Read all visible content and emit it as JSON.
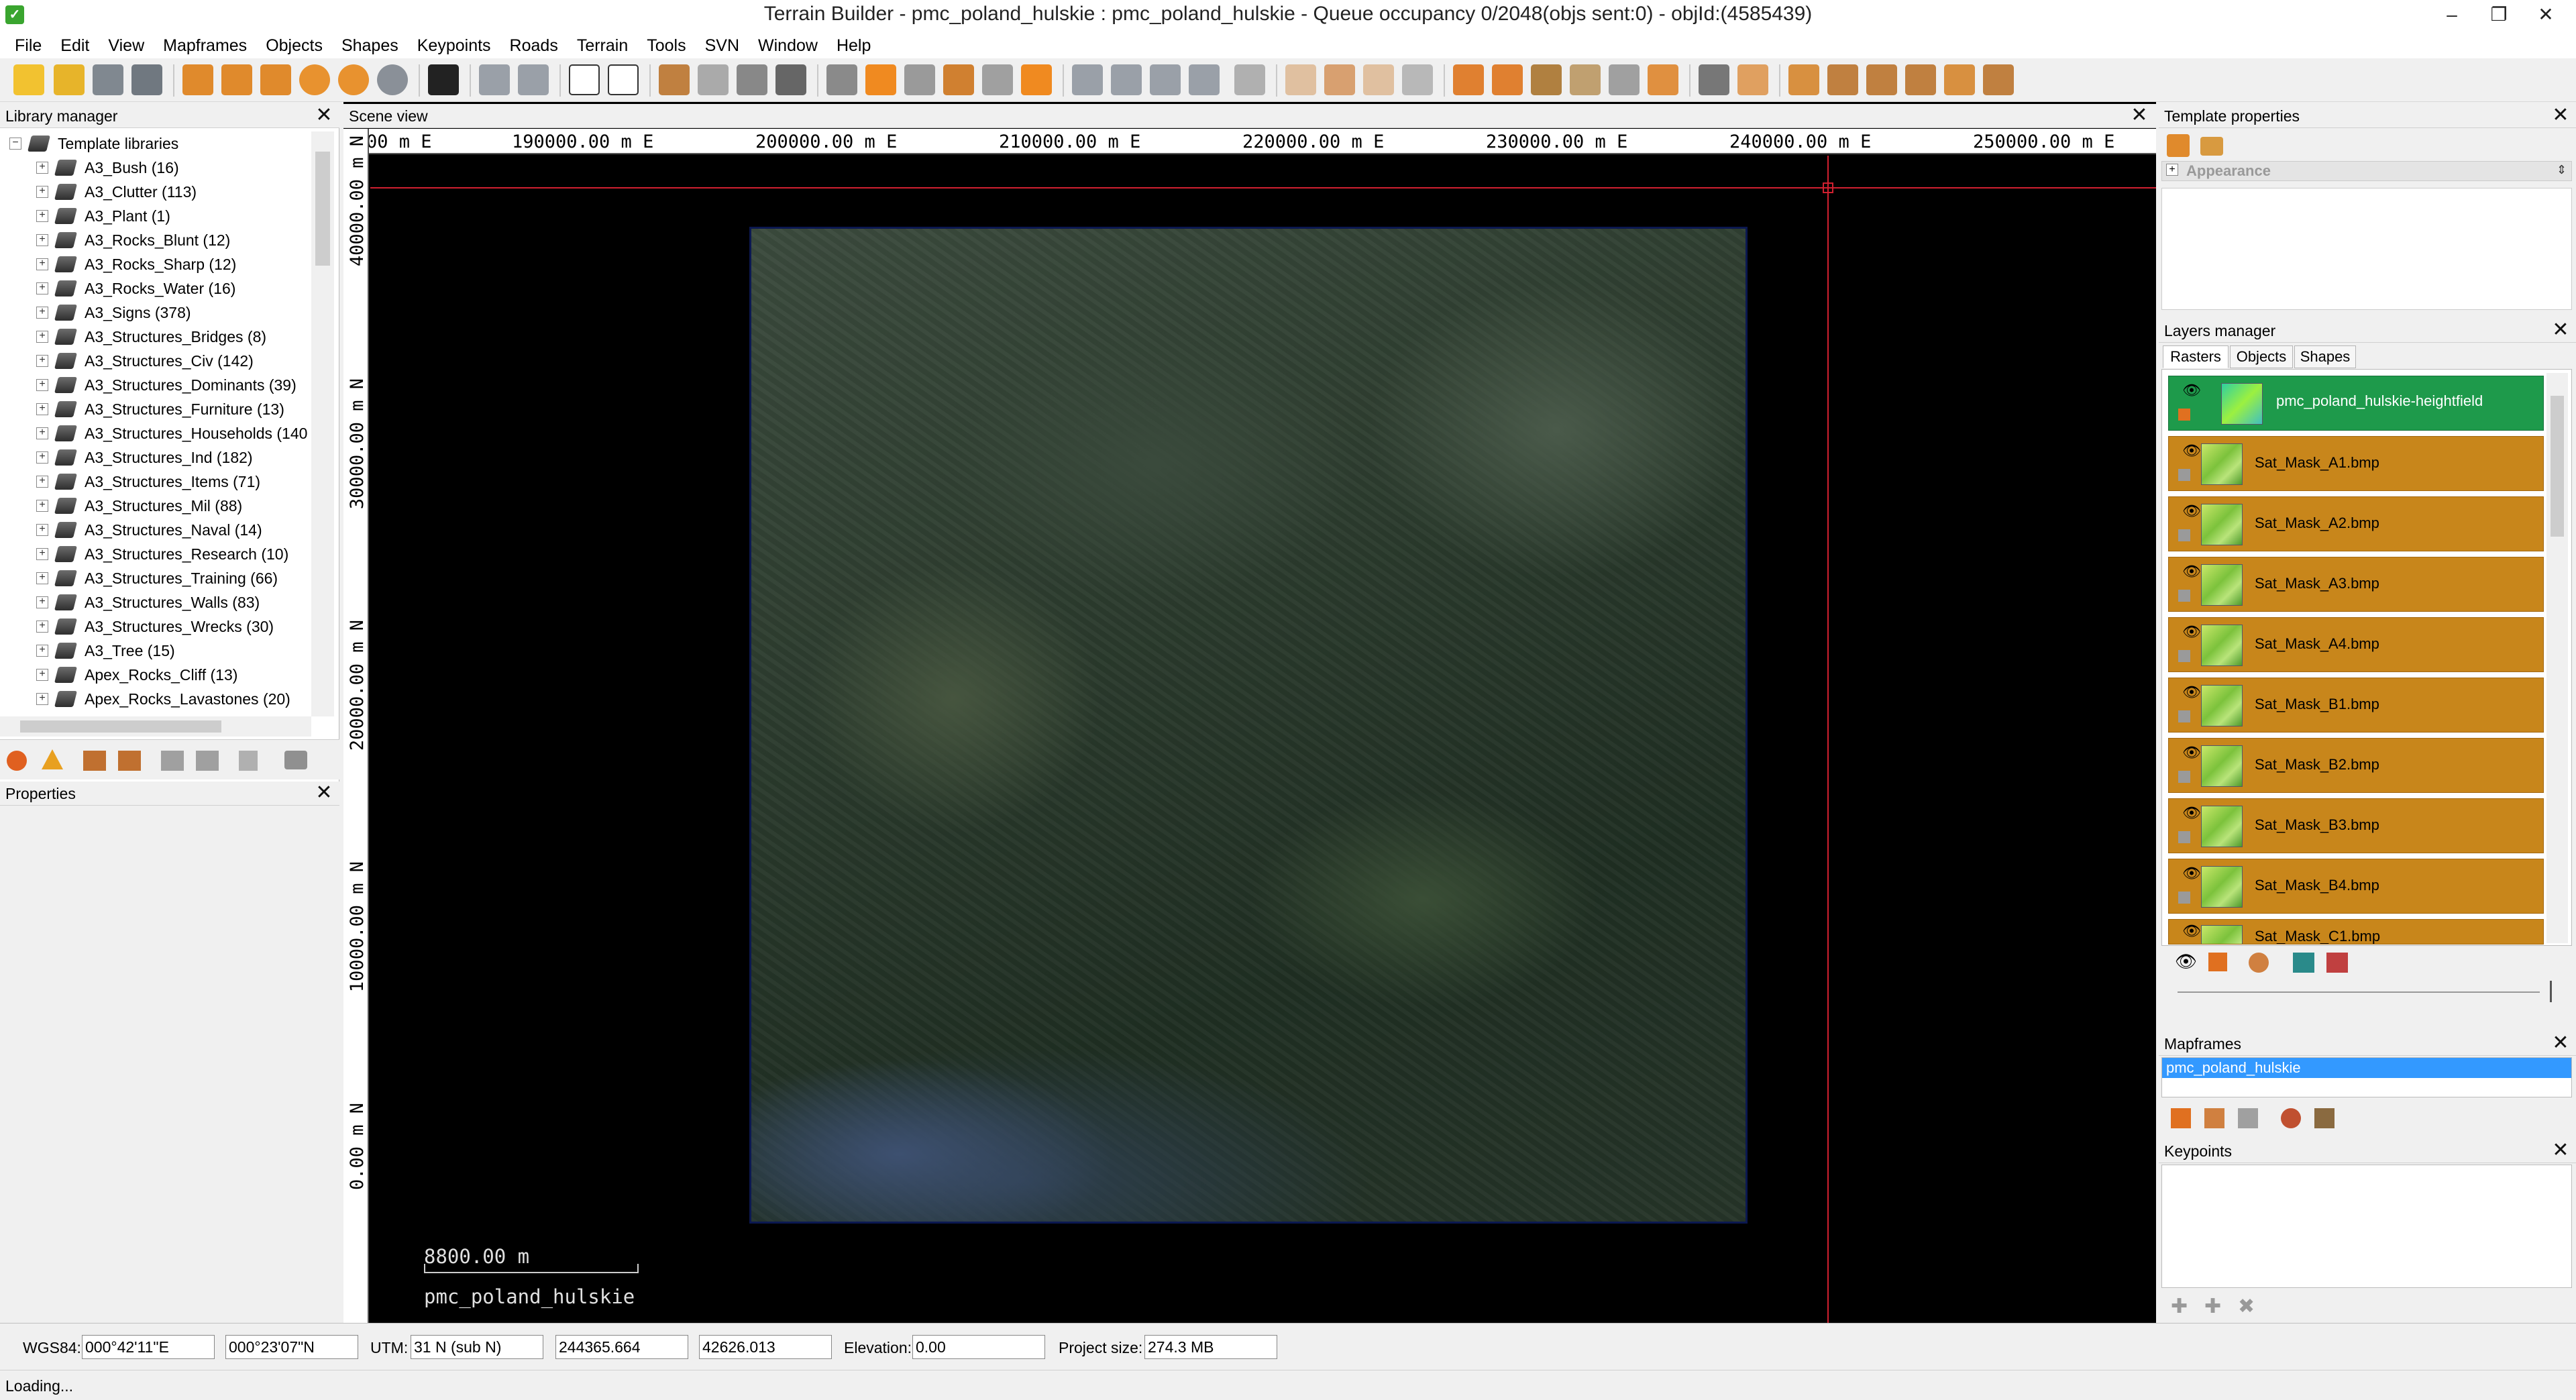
{
  "window": {
    "title": "Terrain Builder - pmc_poland_hulskie : pmc_poland_hulskie - Queue occupancy 0/2048(objs sent:0) - objId:(4585439)",
    "app_icon": "terrain-builder-icon",
    "controls": [
      "minimize",
      "restore",
      "close"
    ]
  },
  "menu": [
    "File",
    "Edit",
    "View",
    "Mapframes",
    "Objects",
    "Shapes",
    "Keypoints",
    "Roads",
    "Terrain",
    "Tools",
    "SVN",
    "Window",
    "Help"
  ],
  "library_manager": {
    "title": "Library manager",
    "root": "Template libraries",
    "items": [
      "A3_Bush (16)",
      "A3_Clutter (113)",
      "A3_Plant (1)",
      "A3_Rocks_Blunt (12)",
      "A3_Rocks_Sharp (12)",
      "A3_Rocks_Water (16)",
      "A3_Signs (378)",
      "A3_Structures_Bridges (8)",
      "A3_Structures_Civ (142)",
      "A3_Structures_Dominants (39)",
      "A3_Structures_Furniture (13)",
      "A3_Structures_Households (140",
      "A3_Structures_Ind (182)",
      "A3_Structures_Items (71)",
      "A3_Structures_Mil (88)",
      "A3_Structures_Naval (14)",
      "A3_Structures_Research (10)",
      "A3_Structures_Training (66)",
      "A3_Structures_Walls (83)",
      "A3_Structures_Wrecks (30)",
      "A3_Tree (15)",
      "Apex_Rocks_Cliff (13)",
      "Apex_Rocks_Lavastones (20)"
    ]
  },
  "properties": {
    "title": "Properties"
  },
  "scene": {
    "title": "Scene view",
    "ruler_x": [
      "00 m E",
      "190000.00 m E",
      "200000.00 m E",
      "210000.00 m E",
      "220000.00 m E",
      "230000.00 m E",
      "240000.00 m E",
      "250000.00 m E"
    ],
    "ruler_y": [
      "40000.00 m N",
      "30000.00 m N",
      "20000.00 m N",
      "10000.00 m N",
      "0.00 m N"
    ],
    "scale_label": "8800.00 m",
    "mapframe_label": "pmc_poland_hulskie"
  },
  "template_properties": {
    "title": "Template properties",
    "section": "Appearance"
  },
  "layers_manager": {
    "title": "Layers manager",
    "tabs": [
      "Rasters",
      "Objects",
      "Shapes"
    ],
    "layers": [
      "pmc_poland_hulskie-heightfield",
      "Sat_Mask_A1.bmp",
      "Sat_Mask_A2.bmp",
      "Sat_Mask_A3.bmp",
      "Sat_Mask_A4.bmp",
      "Sat_Mask_B1.bmp",
      "Sat_Mask_B2.bmp",
      "Sat_Mask_B3.bmp",
      "Sat_Mask_B4.bmp",
      "Sat_Mask_C1.bmp"
    ],
    "colors": {
      "heightfield": "#1e9a4b",
      "mask": "#c8861b"
    }
  },
  "mapframes": {
    "title": "Mapframes",
    "items": [
      "pmc_poland_hulskie"
    ]
  },
  "keypoints": {
    "title": "Keypoints"
  },
  "status": {
    "wgs84_label": "WGS84:",
    "lon": "000°42'11\"E",
    "lat": "000°23'07\"N",
    "utm_label": "UTM:",
    "utm_zone": "31 N  (sub N)",
    "easting": "244365.664",
    "northing": "42626.013",
    "elevation_label": "Elevation:",
    "elevation": "0.00",
    "project_size_label": "Project size:",
    "project_size": "274.3 MB",
    "message": "Loading..."
  }
}
